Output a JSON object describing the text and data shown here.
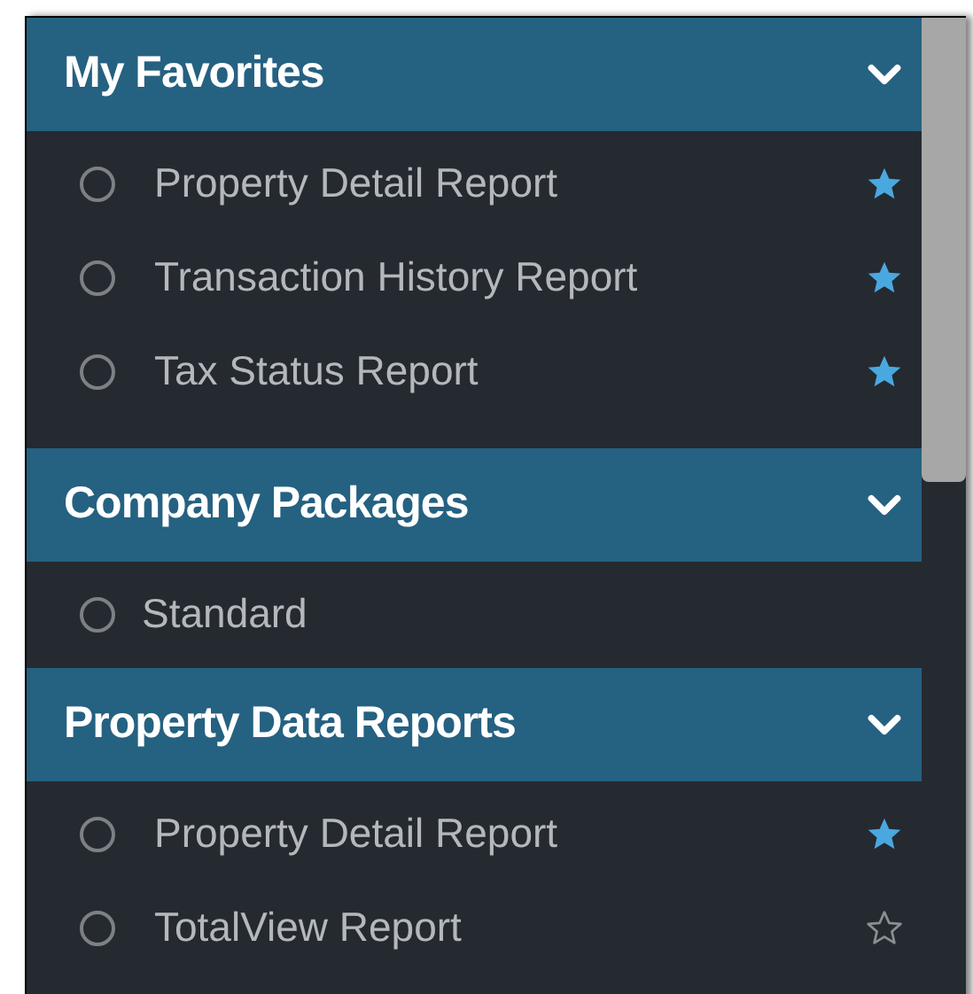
{
  "sections": [
    {
      "title": "My Favorites",
      "expanded": true,
      "items": [
        {
          "label": "Property Detail Report",
          "favorite": true
        },
        {
          "label": "Transaction History Report",
          "favorite": true
        },
        {
          "label": "Tax Status Report",
          "favorite": true
        }
      ]
    },
    {
      "title": "Company Packages",
      "expanded": true,
      "items": [
        {
          "label": "Standard"
        }
      ]
    },
    {
      "title": "Property Data Reports",
      "expanded": true,
      "items": [
        {
          "label": "Property Detail Report",
          "favorite": true
        },
        {
          "label": "TotalView Report",
          "favorite": false
        }
      ]
    }
  ]
}
